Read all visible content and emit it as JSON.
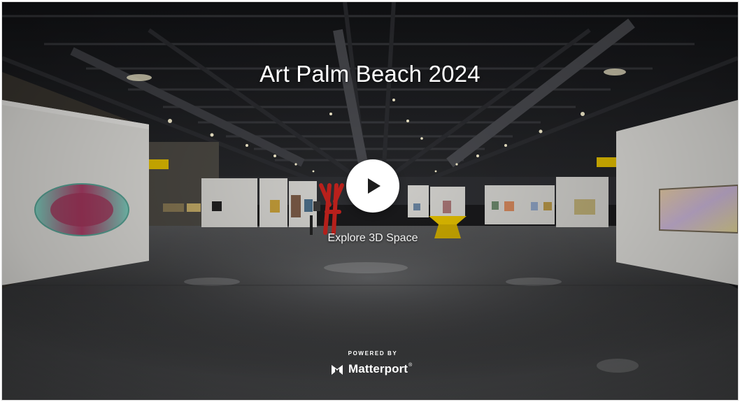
{
  "tour": {
    "title": "Art Palm Beach 2024",
    "cta_label": "Explore 3D Space",
    "play_icon": "play-icon"
  },
  "branding": {
    "powered_by": "POWERED BY",
    "name": "Matterport",
    "trademark": "®",
    "logo_icon": "matterport-logo-icon"
  },
  "colors": {
    "background": "#1a1a1c",
    "text": "#ffffff",
    "accent_yellow": "#e8c300",
    "sculpture_red": "#c8231e"
  }
}
